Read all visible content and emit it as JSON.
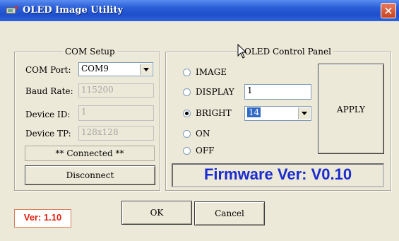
{
  "window": {
    "title": "OLED Image Utility",
    "close_glyph": "✕"
  },
  "com_setup": {
    "legend": "COM Setup",
    "com_port_label": "COM Port:",
    "com_port_value": "COM9",
    "baud_label": "Baud Rate:",
    "baud_value": "115200",
    "device_id_label": "Device ID:",
    "device_id_value": "1",
    "device_tp_label": "Device TP:",
    "device_tp_value": "128x128",
    "status": "** Connected **",
    "disconnect_label": "Disconnect"
  },
  "oled_panel": {
    "legend": "OLED Control Panel",
    "options": [
      {
        "label": "IMAGE",
        "checked": false
      },
      {
        "label": "DISPLAY",
        "checked": false
      },
      {
        "label": "BRIGHT",
        "checked": true
      },
      {
        "label": "ON",
        "checked": false
      },
      {
        "label": "OFF",
        "checked": false
      }
    ],
    "display_value": "1",
    "bright_value": "14",
    "apply_label": "APPLY",
    "firmware": "Firmware Ver: V0.10"
  },
  "footer": {
    "version": "Ver: 1.10",
    "ok_label": "OK",
    "cancel_label": "Cancel"
  },
  "colors": {
    "title_bar": "#2a5fd8",
    "firmware_text": "#1a2bd0",
    "version_text": "#e02010"
  }
}
